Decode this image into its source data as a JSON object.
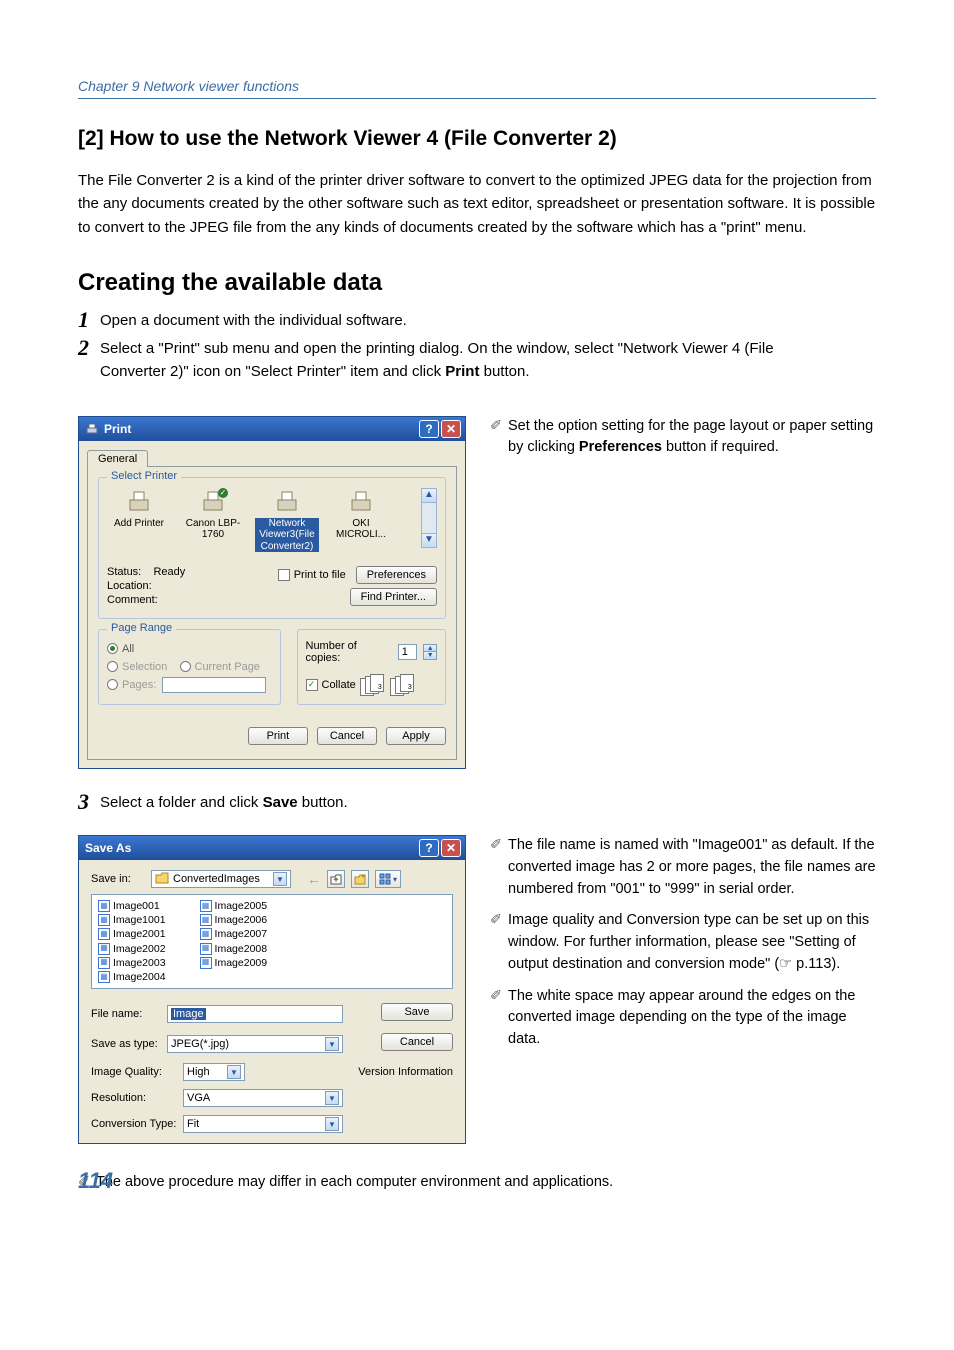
{
  "header": "Chapter 9 Network viewer functions",
  "page_number": "114",
  "section_title": "[2] How to use the Network Viewer 4 (File Converter 2)",
  "intro": "The File Converter 2 is a kind of the printer driver software to convert to the optimized JPEG data for the projection from the any documents created by the other software such as text editor, spreadsheet or presentation software. It is possible to convert to the JPEG file from the any kinds of documents created by the software which has a \"print\" menu.",
  "subsection_title": "Creating the available data",
  "steps": {
    "s1": "Open a document with the individual software.",
    "s2a": "Select a \"Print\" sub menu and open the printing dialog. On the window, select \"Network Viewer 4 (File",
    "s2b": "Converter 2)\" icon on \"Select Printer\" item and click ",
    "s2_bold": "Print",
    "s2_tail": " button.",
    "s3a": "Select a folder and click ",
    "s3_bold": "Save",
    "s3_tail": " button."
  },
  "print_dialog": {
    "title": "Print",
    "tab_general": "General",
    "select_printer_legend": "Select Printer",
    "printers": {
      "add": "Add Printer",
      "canon": "Canon LBP-1760",
      "nv": "Network Viewer3(File Converter2)",
      "oki": "OKI MICROLI..."
    },
    "status_label": "Status:",
    "status_value": "Ready",
    "location_label": "Location:",
    "comment_label": "Comment:",
    "print_to_file": "Print to file",
    "preferences_btn": "Preferences",
    "find_printer_btn": "Find Printer...",
    "page_range_legend": "Page Range",
    "radio_all": "All",
    "radio_selection": "Selection",
    "radio_current": "Current Page",
    "radio_pages": "Pages:",
    "copies_label": "Number of copies:",
    "copies_value": "1",
    "collate_label": "Collate",
    "btn_print": "Print",
    "btn_cancel": "Cancel",
    "btn_apply": "Apply"
  },
  "side_note_1a": "Set the option setting for the page layout or paper setting by clicking ",
  "side_note_1_bold": "Preferences",
  "side_note_1b": " button if required.",
  "saveas_dialog": {
    "title": "Save As",
    "savein_label": "Save in:",
    "savein_folder": "ConvertedImages",
    "files_col1": [
      "Image001",
      "Image1001",
      "Image2001",
      "Image2002",
      "Image2003",
      "Image2004"
    ],
    "files_col2": [
      "Image2005",
      "Image2006",
      "Image2007",
      "Image2008",
      "Image2009"
    ],
    "filename_label": "File name:",
    "filename_value": "Image",
    "saveastype_label": "Save as type:",
    "saveastype_value": "JPEG(*.jpg)",
    "imagequality_label": "Image Quality:",
    "imagequality_value": "High",
    "resolution_label": "Resolution:",
    "resolution_value": "VGA",
    "conversion_label": "Conversion Type:",
    "conversion_value": "Fit",
    "btn_save": "Save",
    "btn_cancel": "Cancel",
    "btn_version": "Version Information"
  },
  "side_notes_2": {
    "n1": "The file name is named with \"Image001\" as default. If the converted image has 2 or more pages, the file names are numbered from \"001\" to \"999\" in serial order.",
    "n2": "Image quality and Conversion type can be set up on this window. For further information, please see \"Setting of output destination and conversion mode\" (☞ p.113).",
    "n3": "The white space may appear around the edges on the converted image depending on the type of the image data."
  },
  "bottom_note": "The above procedure may differ in each computer environment and applications."
}
